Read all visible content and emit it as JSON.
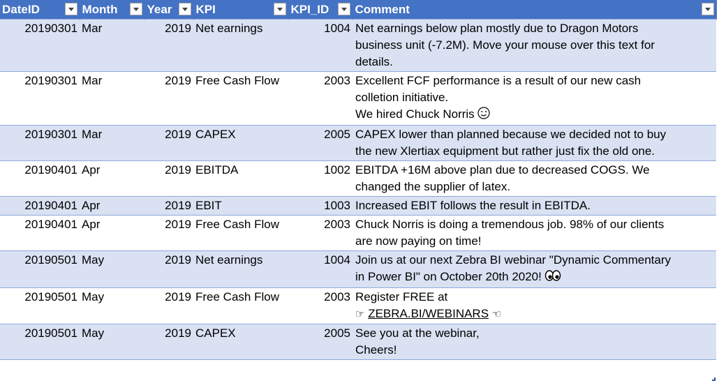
{
  "headers": [
    "DateID",
    "Month",
    "Year",
    "KPI",
    "KPI_ID",
    "Comment"
  ],
  "icons": {
    "filter": "filter-dropdown-icon",
    "wink": "winking-face-icon",
    "eyes": "eyes-icon",
    "point_right": "hand-pointing-right-icon",
    "point_left": "hand-pointing-left-icon"
  },
  "colors": {
    "header": "#4472c4",
    "band": "#d9e1f2",
    "border": "#8ea9db"
  },
  "rows": [
    {
      "date_id": "20190301",
      "month": "Mar",
      "year": "2019",
      "kpi": "Net earnings",
      "kpi_id": "1004",
      "comment": [
        "Net earnings below plan mostly due to Dragon Motors",
        "business unit (-7.2M). Move your mouse over this text for",
        "details."
      ]
    },
    {
      "date_id": "20190301",
      "month": "Mar",
      "year": "2019",
      "kpi": "Free Cash Flow",
      "kpi_id": "2003",
      "comment": [
        "Excellent FCF performance is a result of our new cash",
        "colletion initiative.",
        "We hired Chuck Norris"
      ]
    },
    {
      "date_id": "20190301",
      "month": "Mar",
      "year": "2019",
      "kpi": "CAPEX",
      "kpi_id": "2005",
      "comment": [
        "CAPEX lower than planned because we decided not to buy",
        "the new Xlertiax equipment but rather just fix the old one."
      ]
    },
    {
      "date_id": "20190401",
      "month": "Apr",
      "year": "2019",
      "kpi": "EBITDA",
      "kpi_id": "1002",
      "comment": [
        "EBITDA +16M above plan due to decreased COGS. We",
        "changed the supplier of latex."
      ]
    },
    {
      "date_id": "20190401",
      "month": "Apr",
      "year": "2019",
      "kpi": "EBIT",
      "kpi_id": "1003",
      "comment": [
        "Increased EBIT follows the result in EBITDA."
      ]
    },
    {
      "date_id": "20190401",
      "month": "Apr",
      "year": "2019",
      "kpi": "Free Cash Flow",
      "kpi_id": "2003",
      "comment": [
        "Chuck Norris is doing a tremendous  job. 98% of our clients",
        "are now paying on time!"
      ]
    },
    {
      "date_id": "20190501",
      "month": "May",
      "year": "2019",
      "kpi": "Net earnings",
      "kpi_id": "1004",
      "comment": [
        "Join us at our next Zebra BI webinar \"Dynamic Commentary",
        "in Power BI\" on October 20th 2020!"
      ]
    },
    {
      "date_id": "20190501",
      "month": "May",
      "year": "2019",
      "kpi": "Free Cash Flow",
      "kpi_id": "2003",
      "comment": [
        "Register FREE at",
        "ZEBRA.BI/WEBINARS"
      ]
    },
    {
      "date_id": "20190501",
      "month": "May",
      "year": "2019",
      "kpi": "CAPEX",
      "kpi_id": "2005",
      "comment": [
        "See you at the webinar,",
        "Cheers!"
      ]
    }
  ]
}
